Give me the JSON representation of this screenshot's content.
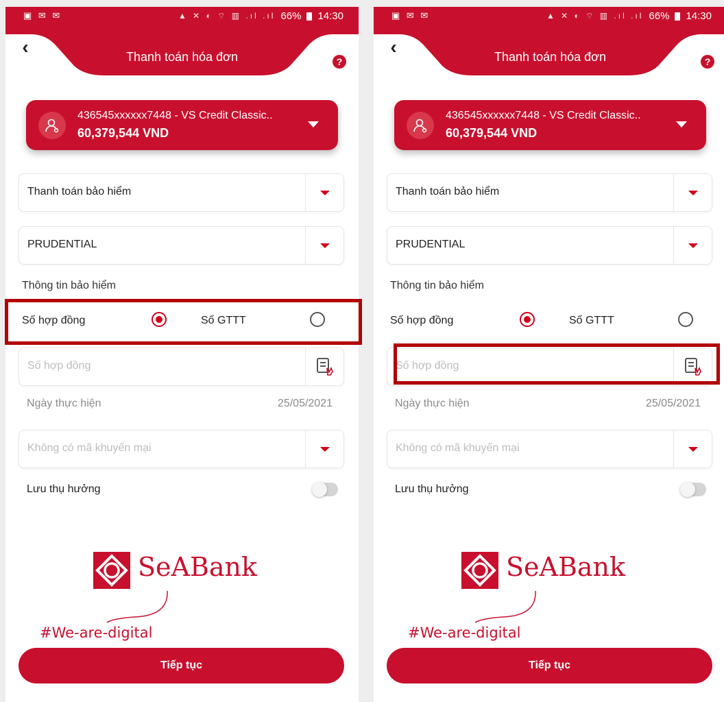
{
  "screens": [
    {
      "status_bar": {
        "left_icons": "▣ ✉ ✉",
        "icons": "▲ ✕ ◐ ⌔ ▥ .ıl .ıl",
        "battery": "66%",
        "time": "14:30"
      },
      "header": {
        "title": "Thanh toán hóa đơn",
        "back_icon": "chevron-left-icon",
        "help_icon": "help-icon"
      },
      "account": {
        "name": "436545xxxxxx7448 - VS Credit Classic..",
        "balance": "60,379,544 VND"
      },
      "service_type": "Thanh toán bảo hiểm",
      "provider": "PRUDENTIAL",
      "section_label": "Thông tin bảo hiểm",
      "radio": {
        "option1": "Số hợp đồng",
        "option2": "Số GTTT",
        "selected": "option1"
      },
      "contract_input_placeholder": "Số hợp đồng",
      "date_label": "Ngày thực hiện",
      "date_value": "25/05/2021",
      "promo_placeholder": "Không có mã khuyến mại",
      "save_beneficiary_label": "Lưu thụ hưởng",
      "save_beneficiary_on": false,
      "logo_text": "SeABank",
      "slogan": "#We-are-digital",
      "continue_label": "Tiếp tục",
      "highlight": "radio-row"
    },
    {
      "status_bar": {
        "left_icons": "▣ ✉ ✉",
        "icons": "▲ ✕ ◐ ⌔ ▥ .ıl .ıl",
        "battery": "66%",
        "time": "14:30"
      },
      "header": {
        "title": "Thanh toán hóa đơn",
        "back_icon": "chevron-left-icon",
        "help_icon": "help-icon"
      },
      "account": {
        "name": "436545xxxxxx7448 - VS Credit Classic..",
        "balance": "60,379,544 VND"
      },
      "service_type": "Thanh toán bảo hiểm",
      "provider": "PRUDENTIAL",
      "section_label": "Thông tin bảo hiểm",
      "radio": {
        "option1": "Số hợp đồng",
        "option2": "Số GTTT",
        "selected": "option1"
      },
      "contract_input_placeholder": "Số hợp đồng",
      "date_label": "Ngày thực hiện",
      "date_value": "25/05/2021",
      "promo_placeholder": "Không có mã khuyến mại",
      "save_beneficiary_label": "Lưu thụ hưởng",
      "save_beneficiary_on": false,
      "logo_text": "SeABank",
      "slogan": "#We-are-digital",
      "continue_label": "Tiếp tục",
      "highlight": "contract-input"
    }
  ],
  "colors": {
    "brand": "#c8102e",
    "highlight": "#b30000"
  }
}
